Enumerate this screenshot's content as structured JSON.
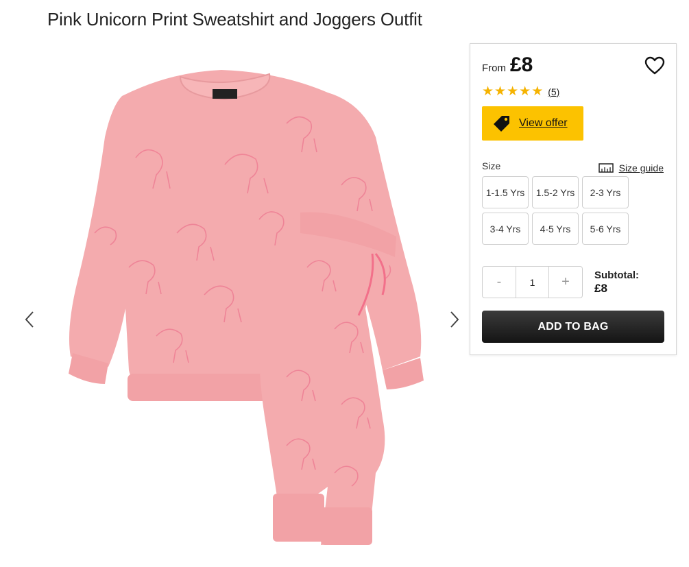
{
  "product": {
    "title": "Pink Unicorn Print Sweatshirt and Joggers Outfit"
  },
  "gallery": {
    "prev_icon": "chevron-left-icon",
    "next_icon": "chevron-right-icon",
    "image_colors": {
      "garment": "#f4a9ac",
      "print": "#f0728a",
      "label": "#222222"
    }
  },
  "purchase": {
    "from_label": "From",
    "price": "£8",
    "rating": {
      "stars": 5,
      "max": 5,
      "count_label": "(5)"
    },
    "offer": {
      "label": "View offer",
      "icon": "price-tag-icon",
      "color": "#fcc200"
    },
    "size": {
      "label": "Size",
      "guide_label": "Size guide",
      "options": [
        "1-1.5 Yrs",
        "1.5-2 Yrs",
        "2-3 Yrs",
        "3-4 Yrs",
        "4-5 Yrs",
        "5-6 Yrs"
      ]
    },
    "quantity": {
      "minus": "-",
      "value": "1",
      "plus": "+"
    },
    "subtotal": {
      "label": "Subtotal:",
      "value": "£8"
    },
    "add_to_bag": "ADD TO BAG"
  }
}
